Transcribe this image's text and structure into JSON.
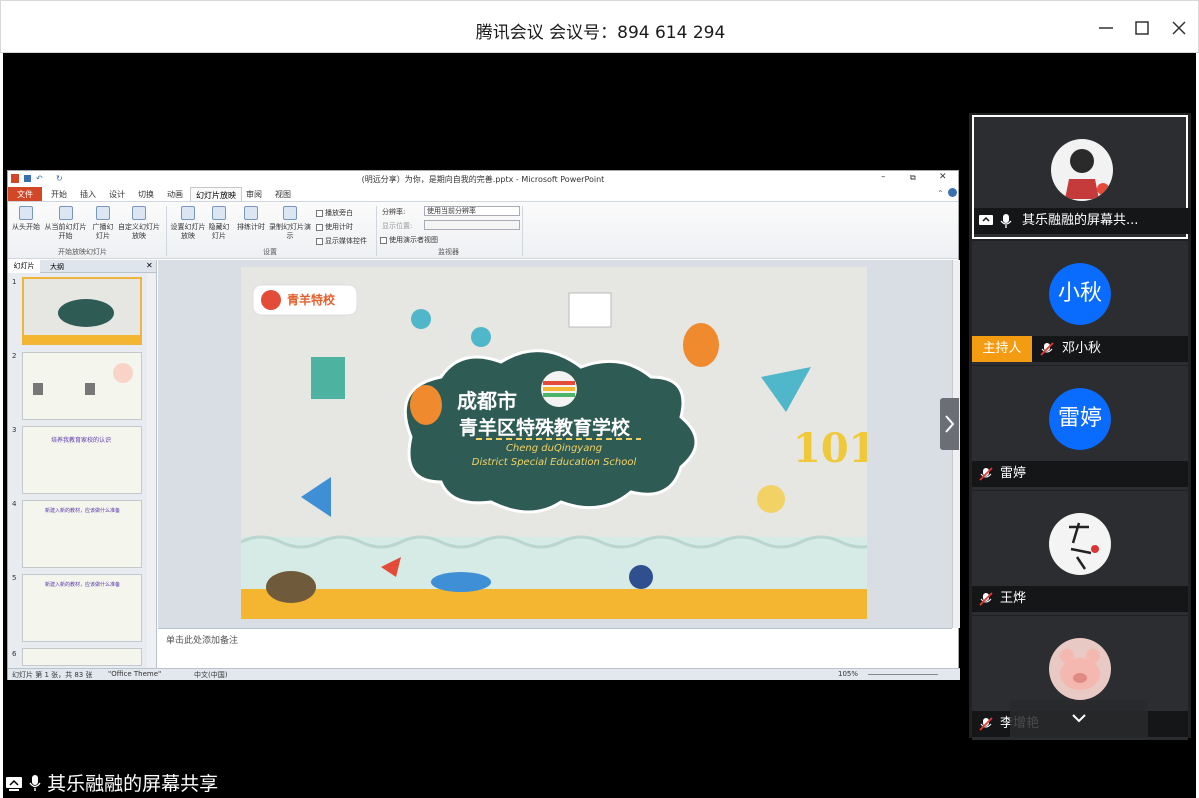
{
  "window": {
    "title": "腾讯会议 会议号：894 614 294"
  },
  "ppt": {
    "title": "(明远分享）为你，是期向自我的完善.pptx - Microsoft PowerPoint",
    "tabs": [
      "文件",
      "开始",
      "插入",
      "设计",
      "切换",
      "动画",
      "幻灯片放映",
      "审阅",
      "视图"
    ],
    "active_tab": "幻灯片放映",
    "ribbon": {
      "from_start": "从头开始",
      "from_current": "从当前幻灯片开始",
      "broadcast": "广播幻灯片",
      "custom": "自定义幻灯片放映",
      "group1": "开始放映幻灯片",
      "setup": "设置幻灯片放映",
      "hide": "隐藏幻灯片",
      "rehearse": "排练计时",
      "record": "录制幻灯片演示",
      "group2": "设置",
      "cb_narration": "播放旁白",
      "cb_timing": "使用计时",
      "cb_media": "显示媒体控件",
      "resolution_label": "分辨率:",
      "resolution_value": "使用当前分辨率",
      "show_on_label": "显示位置:",
      "presenter_view": "使用演示者视图",
      "group3": "监视器"
    },
    "pane_tabs": [
      "幻灯片",
      "大纲"
    ],
    "slide_numbers": [
      "1",
      "2",
      "3",
      "4",
      "5",
      "6"
    ],
    "thumb_texts": {
      "s3": "培养我教育家校的认识",
      "s4": "新建入新的教材，应该做什么准备",
      "s5": "新建入新的教材，应该做什么准备"
    },
    "notes_placeholder": "单击此处添加备注",
    "status": {
      "slide_info": "幻灯片 第 1 张，共 83 张",
      "theme": "\"Office Theme\"",
      "language": "中文(中国)",
      "zoom": "105%"
    }
  },
  "slide": {
    "logo": "青羊特校",
    "title1": "成都市",
    "title2": "青羊区特殊教育学校",
    "en1": "Cheng duQingyang",
    "en2": "District Special Education School",
    "number": "101"
  },
  "participants": [
    {
      "name": "其乐融融的屏幕共...",
      "role": "",
      "avatar_text": "",
      "muted": false,
      "sharing": true,
      "active": true
    },
    {
      "name": "邓小秋",
      "role": "主持人",
      "avatar_text": "小秋",
      "muted": true,
      "sharing": false,
      "active": false
    },
    {
      "name": "雷婷",
      "role": "",
      "avatar_text": "雷婷",
      "muted": true,
      "sharing": false,
      "active": false
    },
    {
      "name": "王烨",
      "role": "",
      "avatar_text": "",
      "muted": true,
      "sharing": false,
      "active": false
    },
    {
      "name": "李增艳",
      "role": "",
      "avatar_text": "",
      "muted": true,
      "sharing": false,
      "active": false
    }
  ],
  "share_label": "其乐融融的屏幕共享",
  "colors": {
    "accent": "#0a6cff",
    "host_badge": "#f39c12",
    "cloud": "#2f5b55",
    "ppt_file_tab": "#d24726"
  }
}
